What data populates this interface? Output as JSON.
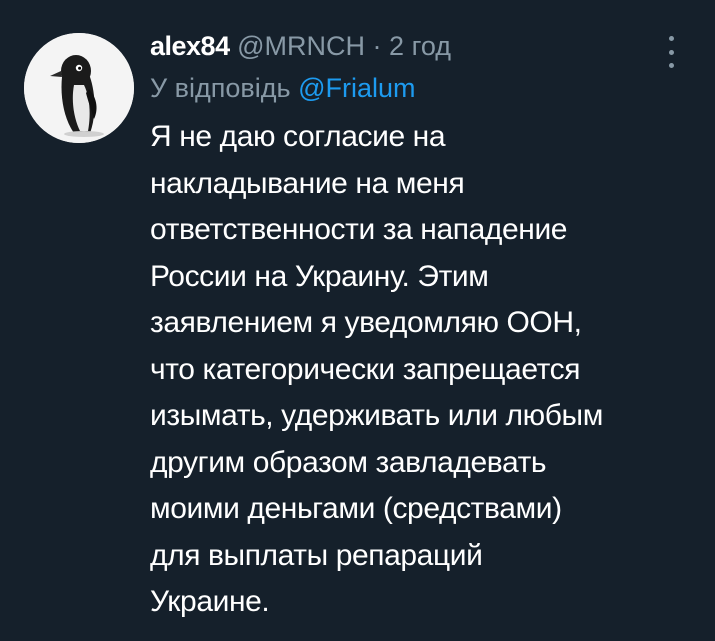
{
  "tweet": {
    "author": {
      "name": "alex84",
      "handle": "@MRNCH",
      "separator": "·",
      "time": "2 год"
    },
    "reply": {
      "prefix": "У відповідь",
      "handle": "@Frialum"
    },
    "body_lines": [
      "Я не даю согласие на",
      "накладывание на меня",
      "ответственности за нападение",
      "России на Украину. Этим",
      "заявлением я уведомляю ООН,",
      "что категорически запрещается",
      "изымать, удерживать или любым",
      "другим образом завладевать",
      "моими деньгами (средствами)",
      "для выплаты репараций",
      "Украине."
    ],
    "more_icon": "vertical-ellipsis-icon",
    "avatar_icon": "penguin-avatar-icon"
  },
  "colors": {
    "background": "#15202b",
    "text": "#ffffff",
    "muted": "#8899a6",
    "link": "#1d9bf0"
  }
}
